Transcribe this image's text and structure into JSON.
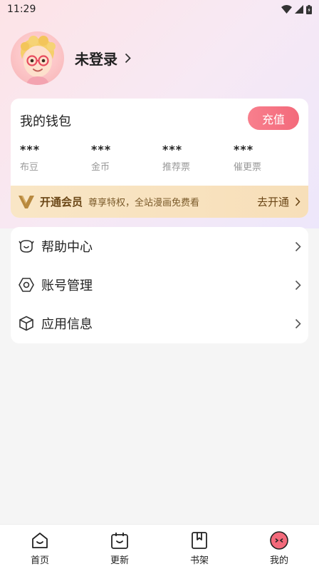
{
  "status_bar": {
    "time": "11:29"
  },
  "profile": {
    "username": "未登录"
  },
  "wallet": {
    "title": "我的钱包",
    "recharge_label": "充值",
    "stats": [
      {
        "value": "***",
        "label": "布豆"
      },
      {
        "value": "***",
        "label": "金币"
      },
      {
        "value": "***",
        "label": "推荐票"
      },
      {
        "value": "***",
        "label": "催更票"
      }
    ],
    "vip": {
      "title": "开通会员",
      "desc": "尊享特权，全站漫画免费看",
      "action": "去开通"
    }
  },
  "menu": {
    "items": [
      {
        "label": "帮助中心",
        "icon": "help-icon"
      },
      {
        "label": "账号管理",
        "icon": "account-icon"
      },
      {
        "label": "应用信息",
        "icon": "app-info-icon"
      }
    ]
  },
  "tabbar": {
    "tabs": [
      {
        "label": "首页",
        "icon": "home-icon"
      },
      {
        "label": "更新",
        "icon": "calendar-icon"
      },
      {
        "label": "书架",
        "icon": "bookshelf-icon"
      },
      {
        "label": "我的",
        "icon": "profile-icon",
        "active": true
      }
    ]
  },
  "colors": {
    "accent": "#f36a7b",
    "vip_text": "#6a4616",
    "vip_bg": "#f8e3c0"
  }
}
